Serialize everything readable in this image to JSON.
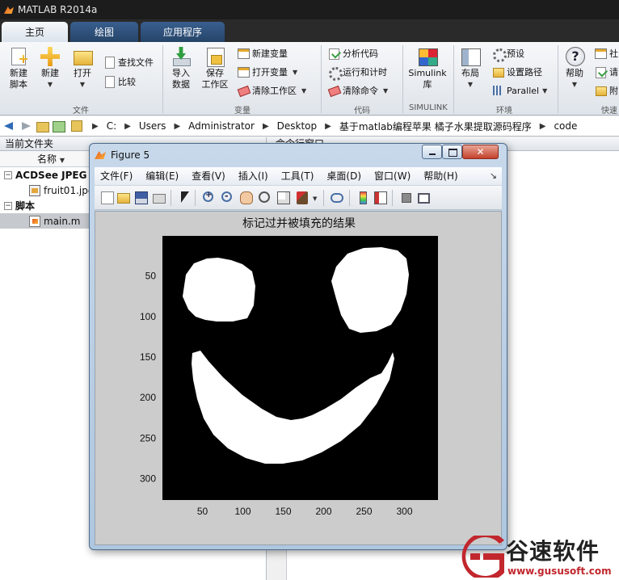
{
  "window": {
    "title": "MATLAB R2014a"
  },
  "ribbon": {
    "tabs": [
      {
        "label": "主页"
      },
      {
        "label": "绘图"
      },
      {
        "label": "应用程序"
      }
    ],
    "file": {
      "new_script": "新建\n脚本",
      "new": "新建",
      "open": "打开",
      "find_files": "查找文件",
      "compare": "比较",
      "section": "文件"
    },
    "variable": {
      "import": "导入\n数据",
      "save_ws": "保存\n工作区",
      "new_var": "新建变量",
      "open_var": "打开变量",
      "clear_ws": "清除工作区",
      "section": "变量"
    },
    "code": {
      "analyze": "分析代码",
      "run_time": "运行和计时",
      "clear_cmd": "清除命令",
      "section": "代码"
    },
    "simulink": {
      "library": "Simulink\n库",
      "section": "SIMULINK"
    },
    "environment": {
      "layout": "布局",
      "preferences": "预设",
      "set_path": "设置路径",
      "parallel": "Parallel",
      "section": "环境"
    },
    "resources": {
      "help": "帮助",
      "community": "社",
      "request": "请",
      "addons": "附",
      "section": "快速"
    }
  },
  "address_bar": {
    "path": [
      "C:",
      "Users",
      "Administrator",
      "Desktop",
      "基于matlab编程苹果 橘子水果提取源码程序",
      "code"
    ]
  },
  "file_browser": {
    "title": "当前文件夹",
    "column_name": "名称",
    "groups": [
      {
        "label": "ACDSee JPEG 图",
        "items": [
          {
            "name": "fruit01.jpg"
          }
        ]
      },
      {
        "label": "脚本",
        "items": [
          {
            "name": "main.m"
          }
        ]
      }
    ]
  },
  "command_window": {
    "title": "命令行窗口"
  },
  "figure": {
    "title": "Figure 5",
    "menu": [
      "文件(F)",
      "编辑(E)",
      "查看(V)",
      "插入(I)",
      "工具(T)",
      "桌面(D)",
      "窗口(W)",
      "帮助(H)"
    ],
    "plot_title": "标记过并被填充的结果",
    "x_ticks": [
      50,
      100,
      150,
      200,
      250,
      300
    ],
    "y_ticks": [
      50,
      100,
      150,
      200,
      250,
      300
    ],
    "image_extent": {
      "x": [
        0.5,
        341.5
      ],
      "y": [
        0.5,
        326.5
      ]
    },
    "colors": {
      "background": "#000000",
      "foreground": "#ffffff",
      "figure_bg": "#cccccc"
    }
  },
  "watermark": {
    "name": "谷速软件",
    "url": "www.gususoft.com"
  }
}
